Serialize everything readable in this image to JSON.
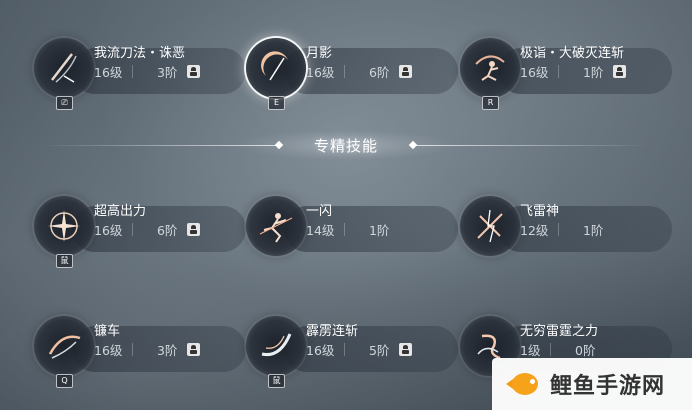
{
  "section_title": "专精技能",
  "skills": [
    {
      "name": "我流刀法・诛恶",
      "level": "16级",
      "stage": "3阶",
      "key": "⎚",
      "locked": true,
      "icon": "blade-slash-icon"
    },
    {
      "name": "月影",
      "level": "16级",
      "stage": "6阶",
      "key": "E",
      "locked": true,
      "icon": "crescent-moon-icon",
      "active": true
    },
    {
      "name": "极诣・大破灭连斩",
      "level": "16级",
      "stage": "1阶",
      "key": "R",
      "locked": true,
      "icon": "leaping-figure-icon"
    },
    {
      "name": "超高出力",
      "level": "16级",
      "stage": "6阶",
      "key": "鼠",
      "locked": true,
      "icon": "burst-star-icon"
    },
    {
      "name": "一闪",
      "level": "14级",
      "stage": "1阶",
      "key": "",
      "locked": false,
      "icon": "dash-figure-icon"
    },
    {
      "name": "飞雷神",
      "level": "12级",
      "stage": "1阶",
      "key": "",
      "locked": false,
      "icon": "cross-slash-icon"
    },
    {
      "name": "镰车",
      "level": "16级",
      "stage": "3阶",
      "key": "Q",
      "locked": true,
      "icon": "sickle-spin-icon"
    },
    {
      "name": "霹雳连斩",
      "level": "16级",
      "stage": "5阶",
      "key": "鼠",
      "locked": true,
      "icon": "lightning-arc-icon"
    },
    {
      "name": "无穷雷霆之力",
      "level": "1级",
      "stage": "0阶",
      "key": "",
      "locked": false,
      "icon": "thunder-swirl-icon"
    }
  ],
  "watermark": "鲤鱼手游网",
  "colors": {
    "accent_glow": "#f2c9a8",
    "pill_bg": "#2c343e",
    "watermark_fish": "#f7a21b"
  }
}
